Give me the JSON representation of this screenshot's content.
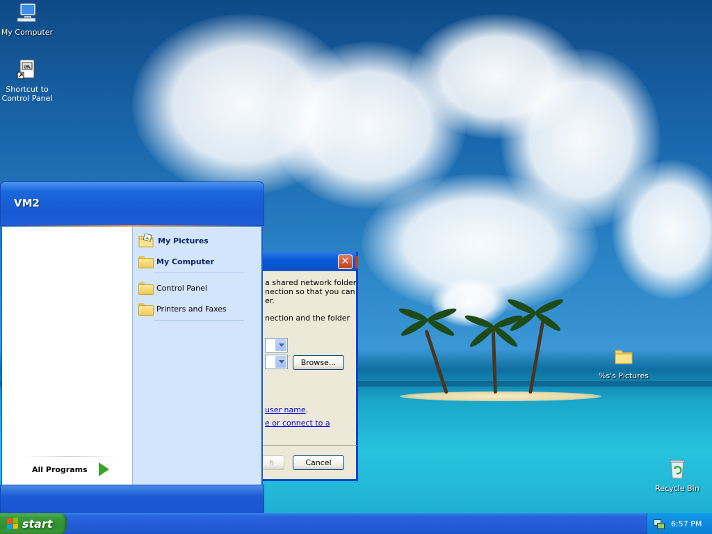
{
  "desktop": {
    "icons": [
      {
        "label": "My Computer",
        "icon": "my-computer-icon"
      },
      {
        "label": "Shortcut to\nControl Panel",
        "icon": "control-panel-shortcut-icon"
      },
      {
        "label": "%s's Pictures",
        "icon": "folder-icon"
      },
      {
        "label": "Recycle Bin",
        "icon": "recycle-bin-icon"
      }
    ]
  },
  "dialog": {
    "text_line1": "a shared network folder",
    "text_line2": "nection so that you can",
    "text_line3": "er.",
    "text_line4": "nection and the folder",
    "browse_label": "Browse...",
    "link1": "user name",
    "link1_suffix": ".",
    "link2": "e or connect to a",
    "finish_label": "h",
    "cancel_label": "Cancel",
    "close_glyph": "✕"
  },
  "start_menu": {
    "user_name": "VM2",
    "right_items": [
      {
        "label": "My Pictures",
        "bold": true,
        "icon": "my-pictures-icon"
      },
      {
        "label": "My Computer",
        "bold": true,
        "icon": "my-computer-icon"
      },
      {
        "label": "Control Panel",
        "bold": false,
        "icon": "control-panel-icon"
      },
      {
        "label": "Printers and Faxes",
        "bold": false,
        "icon": "printers-icon"
      }
    ],
    "all_programs": "All Programs"
  },
  "taskbar": {
    "start_label": "start",
    "clock": "6:57 PM"
  },
  "colors": {
    "taskbar_blue": "#245dd8",
    "start_green": "#3b9b3a",
    "start_menu_right_panel": "#d3e5fa",
    "tray_blue": "#0f8ae0"
  }
}
